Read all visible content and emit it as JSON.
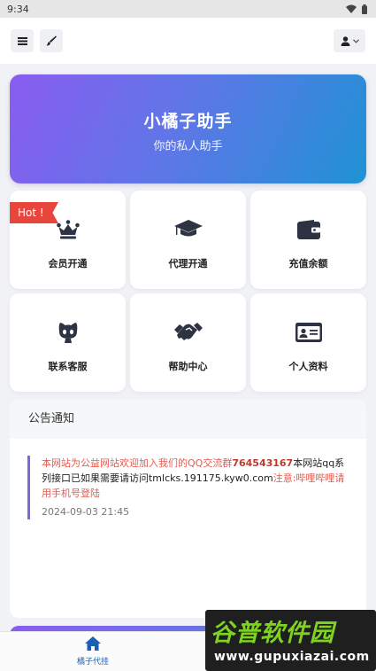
{
  "status_bar": {
    "time": "9:34"
  },
  "header": {
    "menu_icon": "hamburger-icon",
    "theme_icon": "brush-icon",
    "user_icon": "user-icon"
  },
  "hero": {
    "title": "小橘子助手",
    "subtitle": "你的私人助手"
  },
  "badge": {
    "hot": "Hot !"
  },
  "grid": [
    {
      "label": "会员开通",
      "icon": "crown-icon"
    },
    {
      "label": "代理开通",
      "icon": "graduation-cap-icon"
    },
    {
      "label": "充值余额",
      "icon": "wallet-icon"
    },
    {
      "label": "联系客服",
      "icon": "github-icon"
    },
    {
      "label": "帮助中心",
      "icon": "handshake-icon"
    },
    {
      "label": "个人资料",
      "icon": "id-card-icon"
    }
  ],
  "notice": {
    "title": "公告通知",
    "part1": "本网站为公益网站欢迎加入我们的QQ交流群",
    "group": "764543167",
    "part2": "本网站qq系列接口已如果需要请访问tmlcks.191175.kyw0.com",
    "part3": "注意:哔哩哔哩请用手机号登陆",
    "date": "2024-09-03 21:45"
  },
  "bottom_nav": {
    "home_label": "橘子代挂"
  },
  "watermark": {
    "logo": "谷普软件园",
    "url": "www.gupuxiazai.com"
  },
  "colors": {
    "hero_start": "#8a5cf0",
    "hero_end": "#1f92d4",
    "hot": "#e8453c",
    "nav_active": "#1a5fb4",
    "notice_red": "#e45a4f"
  }
}
